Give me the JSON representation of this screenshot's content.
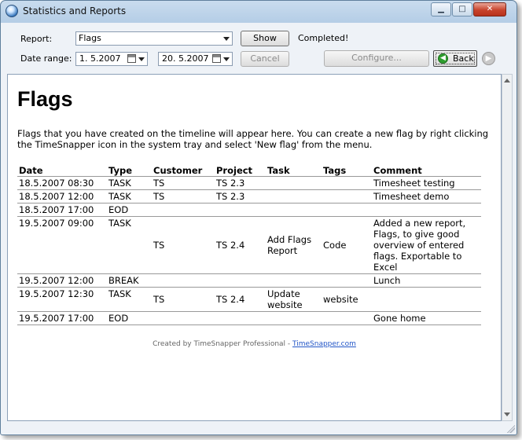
{
  "window": {
    "title": "Statistics and Reports"
  },
  "toolbar": {
    "report_label": "Report:",
    "report_value": "Flags",
    "date_range_label": "Date range:",
    "date_from": "1.  5.2007",
    "date_to": "20.  5.2007",
    "show_label": "Show",
    "cancel_label": "Cancel",
    "status": "Completed!",
    "configure_label": "Configure...",
    "back_label": "Back"
  },
  "report": {
    "heading": "Flags",
    "intro": "Flags that you have created on the timeline will appear here. You can create a new flag by right clicking the TimeSnapper icon in the system tray and select 'New flag' from the menu.",
    "columns": [
      "Date",
      "Type",
      "Customer",
      "Project",
      "Task",
      "Tags",
      "Comment"
    ],
    "rows": [
      [
        "18.5.2007 08:30",
        "TASK",
        "TS",
        "TS 2.3",
        "",
        "",
        "Timesheet testing"
      ],
      [
        "18.5.2007 12:00",
        "TASK",
        "TS",
        "TS 2.3",
        "",
        "",
        "Timesheet demo"
      ],
      [
        "18.5.2007 17:00",
        "EOD",
        "",
        "",
        "",
        "",
        ""
      ],
      [
        "19.5.2007 09:00",
        "TASK",
        "TS",
        "TS 2.4",
        "Add Flags Report",
        "Code",
        "Added a new report, Flags, to give good overview of entered flags. Exportable to Excel"
      ],
      [
        "19.5.2007 12:00",
        "BREAK",
        "",
        "",
        "",
        "",
        "Lunch"
      ],
      [
        "19.5.2007 12:30",
        "TASK",
        "TS",
        "TS 2.4",
        "Update website",
        "website",
        ""
      ],
      [
        "19.5.2007 17:00",
        "EOD",
        "",
        "",
        "",
        "",
        "Gone home"
      ]
    ],
    "footer_text": "Created by TimeSnapper Professional - ",
    "footer_link": "TimeSnapper.com"
  }
}
